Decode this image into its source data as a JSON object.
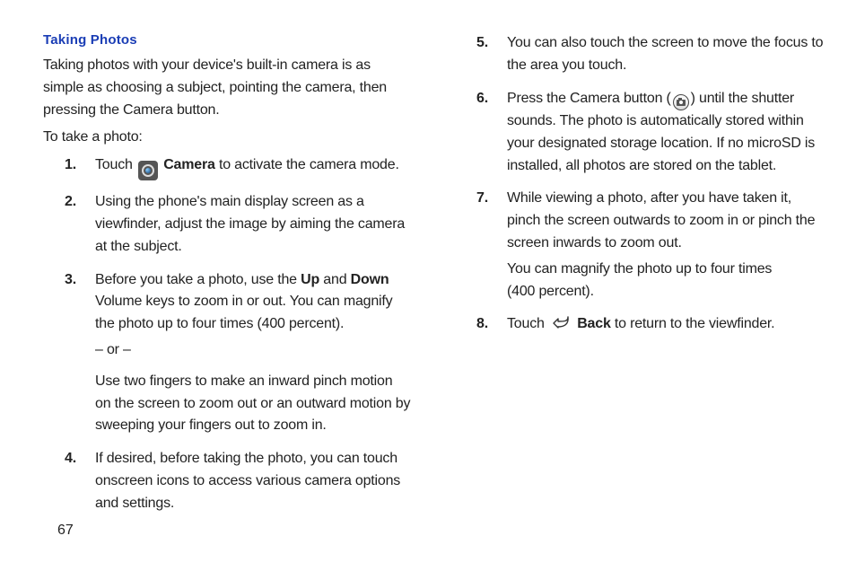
{
  "section_title": "Taking Photos",
  "intro": "Taking photos with your device's built-in camera is as simple as choosing a subject, pointing the camera, then pressing the Camera button.",
  "lead_in": "To take a photo:",
  "steps": {
    "s1": {
      "pre": "Touch ",
      "bold": "Camera",
      "post": " to activate the camera mode."
    },
    "s2": "Using the phone's main display screen as a viewfinder, adjust the image by aiming the camera at the subject.",
    "s3": {
      "pre1": "Before you take a photo, use the ",
      "b1": "Up",
      "mid1": " and ",
      "b2": "Down",
      "post1": " Volume keys to zoom in or out. You can magnify the photo up to four times (400 percent).",
      "or": "– or –",
      "alt": "Use two fingers to make an inward pinch motion on the screen to zoom out or an outward motion by sweeping your fingers out to zoom in."
    },
    "s4": "If desired, before taking the photo, you can touch onscreen icons to access various camera options and settings.",
    "s5": "You can also touch the screen to move the focus to the area you touch.",
    "s6": {
      "pre": "Press the Camera button (",
      "post": ") until the shutter sounds. The photo is automatically stored within your designated storage location. If no microSD is installed, all photos are stored on the tablet."
    },
    "s7": {
      "main": "While viewing a photo, after you have taken it, pinch the screen outwards to zoom in or pinch the screen inwards to zoom out.",
      "sub1": "You can magnify the photo up to four times",
      "sub2": "(400 percent)."
    },
    "s8": {
      "pre": "Touch ",
      "bold": "Back",
      "post": " to return to the viewfinder."
    }
  },
  "page_number": "67"
}
